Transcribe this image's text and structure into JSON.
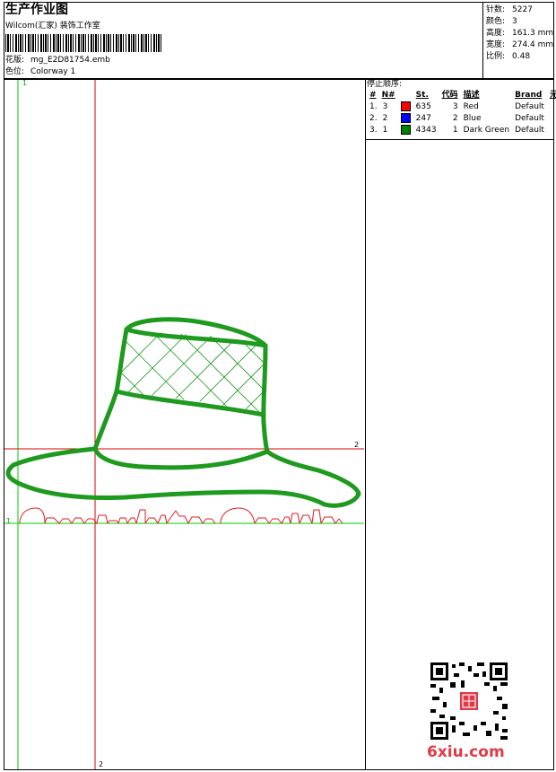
{
  "header": {
    "title": "生产作业图",
    "software": "Wilcom(汇家) 装饰工作室",
    "design_label": "花版:",
    "design_file": "mg_E2D81754.emb",
    "colorway_label": "色位:",
    "colorway": "Colorway 1"
  },
  "stats": [
    {
      "label": "针数:",
      "value": "5227"
    },
    {
      "label": "颜色:",
      "value": "3"
    },
    {
      "label": "高度:",
      "value": "161.3 mm"
    },
    {
      "label": "宽度:",
      "value": "274.4 mm"
    },
    {
      "label": "比例:",
      "value": "0.48"
    }
  ],
  "stop_sequence": {
    "title": "停止顺序:",
    "headers": [
      "#",
      "N#",
      "St.",
      "代码",
      "描述",
      "Brand",
      "元素"
    ],
    "rows": [
      {
        "num": "1.",
        "n": "3",
        "color": "#ff0000",
        "stitches": "635",
        "code": "3",
        "desc": "Red",
        "brand": "Default"
      },
      {
        "num": "2.",
        "n": "2",
        "color": "#0000ff",
        "stitches": "247",
        "code": "2",
        "desc": "Blue",
        "brand": "Default"
      },
      {
        "num": "3.",
        "n": "1",
        "color": "#008000",
        "stitches": "4343",
        "code": "1",
        "desc": "Dark Green",
        "brand": "Default"
      }
    ]
  },
  "guides": {
    "green_v_label": "1",
    "green_h_label": "1",
    "red_h_label": "2",
    "red_v_label": "2"
  },
  "colors": {
    "guide_green": "#00cc00",
    "guide_red": "#dd0000",
    "thread_green": "#1e9a1e",
    "thread_red": "#e21b1b"
  },
  "watermark": {
    "text": "6xiu.com"
  }
}
